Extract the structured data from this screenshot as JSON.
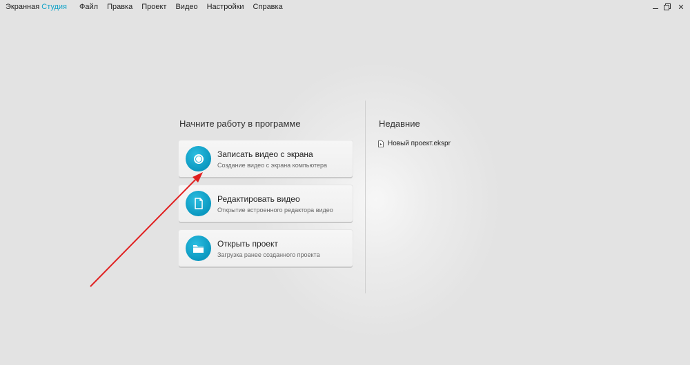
{
  "titlebar": {
    "app_name_part1": "Экранная",
    "app_name_part2": "Студия",
    "menu": [
      "Файл",
      "Правка",
      "Проект",
      "Видео",
      "Настройки",
      "Справка"
    ],
    "controls": {
      "minimize": "",
      "restore": "",
      "close": "✕"
    }
  },
  "start": {
    "heading": "Начните работу в программе",
    "cards": [
      {
        "title": "Записать видео с экрана",
        "subtitle": "Создание видео с экрана компьютера",
        "icon": "record-icon"
      },
      {
        "title": "Редактировать видео",
        "subtitle": "Открытие встроенного редактора видео",
        "icon": "document-icon"
      },
      {
        "title": "Открыть проект",
        "subtitle": "Загрузка ранее созданного проекта",
        "icon": "folder-icon"
      }
    ]
  },
  "recent": {
    "heading": "Недавние",
    "items": [
      {
        "name": "Новый проект.ekspr",
        "icon": "project-file-icon"
      }
    ]
  },
  "colors": {
    "accent": "#13a3c8",
    "annotation_arrow": "#e02020"
  }
}
